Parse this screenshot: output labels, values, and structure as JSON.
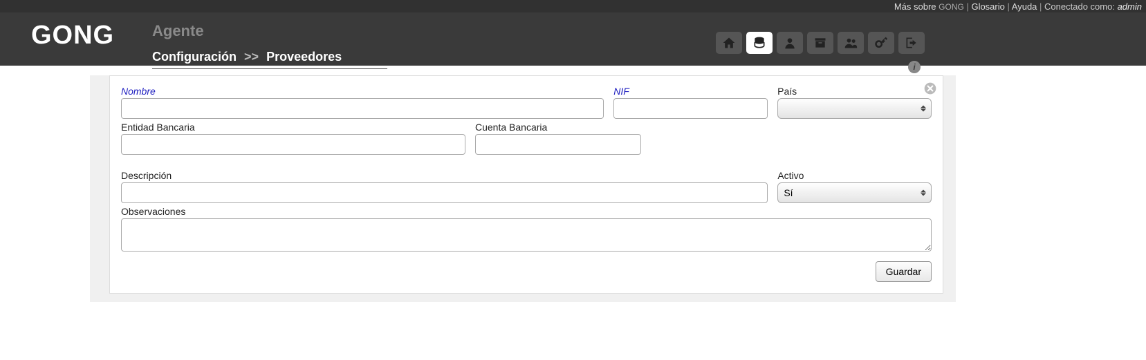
{
  "topbar": {
    "more_about": "Más sobre",
    "brand_mini": "GONG",
    "glossary": "Glosario",
    "help": "Ayuda",
    "connected_as": "Conectado como:",
    "user": "admin"
  },
  "header": {
    "logo": "GONG",
    "section": "Agente",
    "breadcrumb_1": "Configuración",
    "breadcrumb_sep": ">>",
    "breadcrumb_2": "Proveedores"
  },
  "form": {
    "labels": {
      "nombre": "Nombre",
      "nif": "NIF",
      "pais": "País",
      "entidad_bancaria": "Entidad Bancaria",
      "cuenta_bancaria": "Cuenta Bancaria",
      "descripcion": "Descripción",
      "activo": "Activo",
      "observaciones": "Observaciones"
    },
    "values": {
      "nombre": "",
      "nif": "",
      "pais": "",
      "entidad_bancaria": "",
      "cuenta_bancaria": "",
      "descripcion": "",
      "activo": "Sí",
      "observaciones": ""
    },
    "buttons": {
      "guardar": "Guardar"
    }
  }
}
